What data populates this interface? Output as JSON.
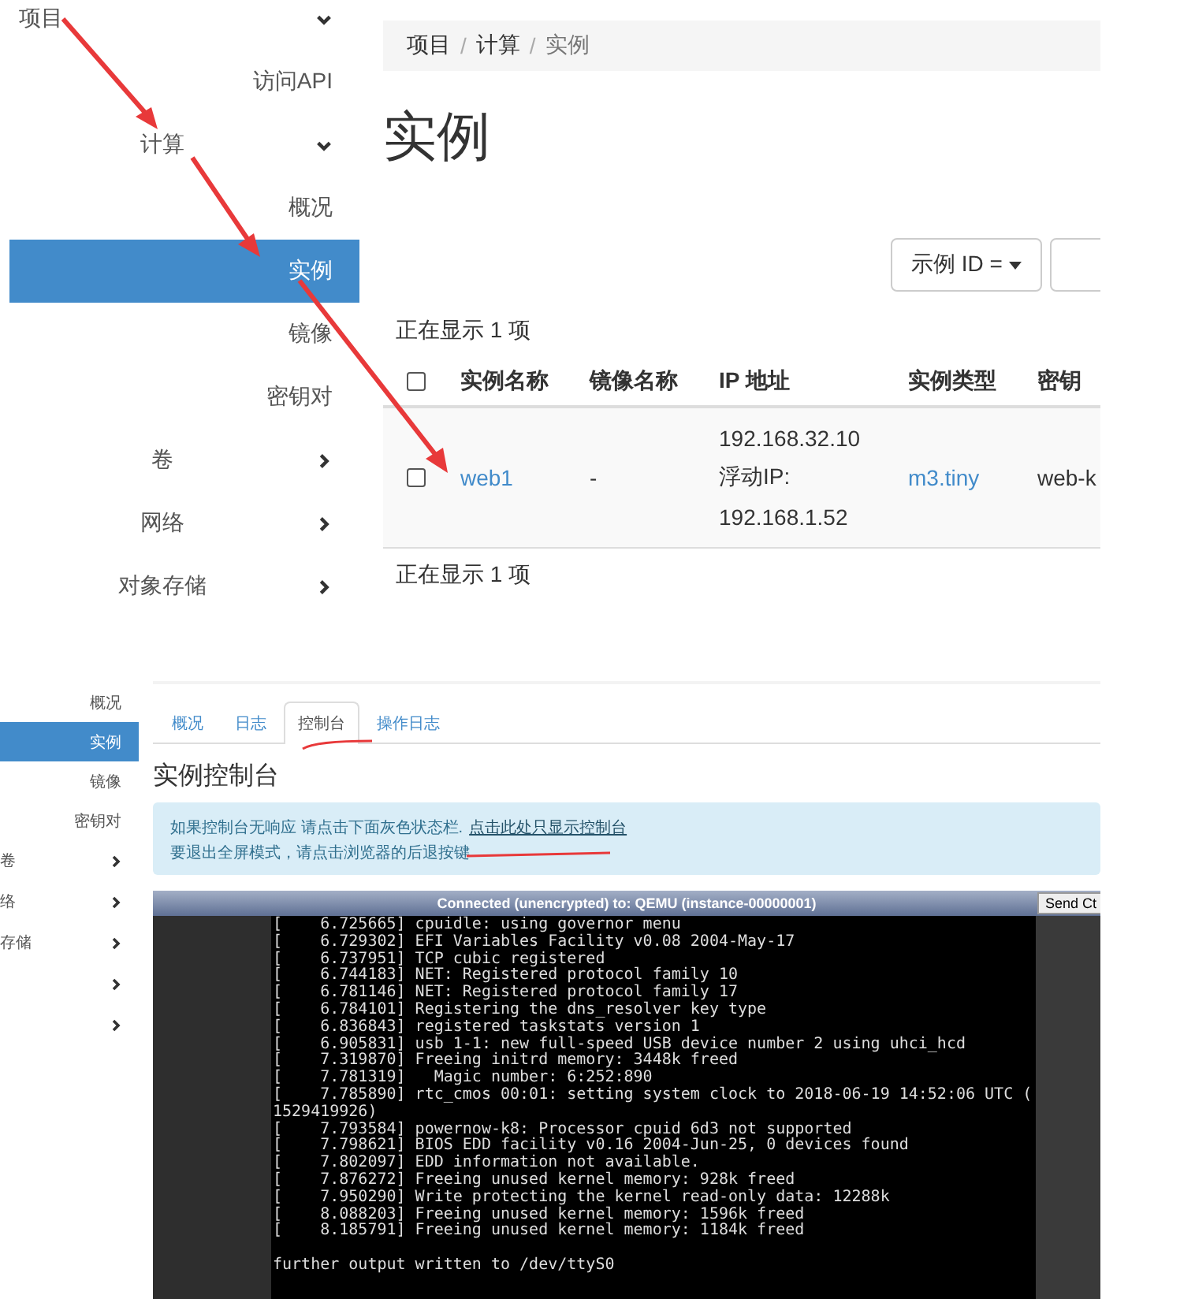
{
  "instances_page": {
    "sidebar": {
      "items": [
        {
          "label": "项目",
          "selected": false,
          "expanded": true,
          "children": [
            {
              "label": "访问API",
              "selected": false
            },
            {
              "label": "计算",
              "selected": false,
              "expanded": true,
              "children": [
                {
                  "label": "概况",
                  "selected": false
                },
                {
                  "label": "实例",
                  "selected": true
                },
                {
                  "label": "镜像",
                  "selected": false
                },
                {
                  "label": "密钥对",
                  "selected": false
                }
              ]
            },
            {
              "label": "卷",
              "selected": false,
              "expanded": false
            },
            {
              "label": "网络",
              "selected": false,
              "expanded": false
            },
            {
              "label": "对象存储",
              "selected": false,
              "expanded": false
            }
          ]
        }
      ]
    },
    "breadcrumb": [
      "项目",
      "计算",
      "实例"
    ],
    "breadcrumb_separator": "/",
    "title": "实例",
    "filter_button": "示例 ID =",
    "count_top": "正在显示 1 项",
    "table": {
      "all_checked": false,
      "columns": [
        "实例名称",
        "镜像名称",
        "IP 地址",
        "实例类型",
        "密钥"
      ],
      "rows": [
        {
          "checked": false,
          "name": "web1",
          "image": "-",
          "ip": [
            "192.168.32.10",
            "浮动IP:",
            "192.168.1.52"
          ],
          "type": "m3.tiny",
          "key": "web-k"
        }
      ]
    },
    "count_bottom": "正在显示 1 项"
  },
  "console_page": {
    "sidebar": {
      "items": [
        {
          "label": "概况",
          "selected": false
        },
        {
          "label": "实例",
          "selected": true
        },
        {
          "label": "镜像",
          "selected": false
        },
        {
          "label": "密钥对",
          "selected": false
        }
      ],
      "sections": [
        {
          "label": "卷",
          "expanded": false
        },
        {
          "label": "络",
          "expanded": false
        },
        {
          "label": "存储",
          "expanded": false
        },
        {
          "expanded": false
        },
        {
          "expanded": false
        }
      ]
    },
    "tabs": [
      {
        "label": "概况",
        "selected": false
      },
      {
        "label": "日志",
        "selected": false
      },
      {
        "label": "控制台",
        "selected": true
      },
      {
        "label": "操作日志",
        "selected": false
      }
    ],
    "title": "实例控制台",
    "info": {
      "line_1": "如果控制台无响应 请点击下面灰色状态栏.",
      "link": "点击此处只显示控制台",
      "line_2": "要退出全屏模式，请点击浏览器的后退按键"
    },
    "console": {
      "title": "Connected (unencrypted) to: QEMU (instance-00000001)",
      "button": "Send Ct",
      "lines": [
        "[    6.725665] cpuidle: using governor menu",
        "[    6.729302] EFI Variables Facility v0.08 2004-May-17",
        "[    6.737951] TCP cubic registered",
        "[    6.744183] NET: Registered protocol family 10",
        "[    6.781146] NET: Registered protocol family 17",
        "[    6.784101] Registering the dns_resolver key type",
        "[    6.836843] registered taskstats version 1",
        "[    6.905831] usb 1-1: new full-speed USB device number 2 using uhci_hcd",
        "[    7.319870] Freeing initrd memory: 3448k freed",
        "[    7.781319]   Magic number: 6:252:890",
        "[    7.785890] rtc_cmos 00:01: setting system clock to 2018-06-19 14:52:06 UTC (",
        "1529419926)",
        "[    7.793584] powernow-k8: Processor cpuid 6d3 not supported",
        "[    7.798621] BIOS EDD facility v0.16 2004-Jun-25, 0 devices found",
        "[    7.802097] EDD information not available.",
        "[    7.876272] Freeing unused kernel memory: 928k freed",
        "[    7.950290] Write protecting the kernel read-only data: 12288k",
        "[    8.088203] Freeing unused kernel memory: 1596k freed",
        "[    8.185791] Freeing unused kernel memory: 1184k freed"
      ],
      "last_line": "further output written to /dev/ttyS0"
    }
  }
}
